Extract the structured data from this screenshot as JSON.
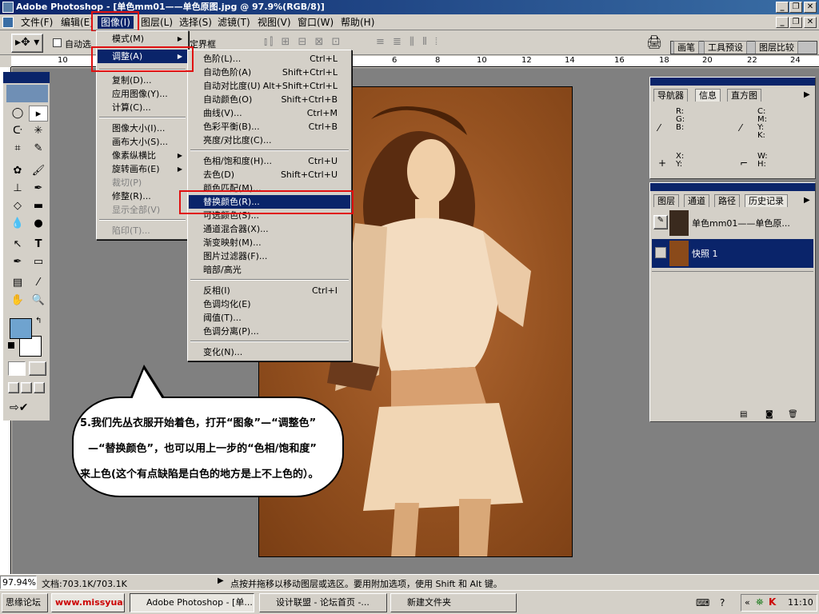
{
  "window": {
    "title": "Adobe Photoshop - [单色mm01——单色原图.jpg @ 97.9%(RGB/8)]",
    "btn_min": "_",
    "btn_restore": "❐",
    "btn_close": "✕"
  },
  "menubar": {
    "items": [
      "文件(F)",
      "编辑(E)",
      "图像(I)",
      "图层(L)",
      "选择(S)",
      "滤镜(T)",
      "视图(V)",
      "窗口(W)",
      "帮助(H)"
    ]
  },
  "options": {
    "auto_select": "自动选",
    "bounding_box": "定界框",
    "palette_tabs": [
      "画笔",
      "工具预设",
      "图层比较"
    ]
  },
  "ruler_h_ticks": [
    "10",
    "6",
    "8",
    "10",
    "12",
    "14",
    "16",
    "18",
    "20",
    "22",
    "24"
  ],
  "image_menu": {
    "items": [
      {
        "label": "模式(M)",
        "submenu": true
      },
      {
        "label": "调整(A)",
        "submenu": true,
        "selected": true
      },
      {
        "label": "复制(D)..."
      },
      {
        "label": "应用图像(Y)..."
      },
      {
        "label": "计算(C)..."
      },
      {
        "label": "图像大小(I)..."
      },
      {
        "label": "画布大小(S)..."
      },
      {
        "label": "像素纵横比",
        "submenu": true
      },
      {
        "label": "旋转画布(E)",
        "submenu": true
      },
      {
        "label": "裁切(P)",
        "disabled": true
      },
      {
        "label": "修整(R)..."
      },
      {
        "label": "显示全部(V)",
        "disabled": true
      },
      {
        "label": "陷印(T)...",
        "disabled": true
      }
    ]
  },
  "adjust_menu": {
    "items": [
      {
        "label": "色阶(L)...",
        "shortcut": "Ctrl+L"
      },
      {
        "label": "自动色阶(A)",
        "shortcut": "Shift+Ctrl+L"
      },
      {
        "label": "自动对比度(U)",
        "shortcut": "Alt+Shift+Ctrl+L"
      },
      {
        "label": "自动颜色(O)",
        "shortcut": "Shift+Ctrl+B"
      },
      {
        "label": "曲线(V)...",
        "shortcut": "Ctrl+M"
      },
      {
        "label": "色彩平衡(B)...",
        "shortcut": "Ctrl+B"
      },
      {
        "label": "亮度/对比度(C)...",
        "shortcut": ""
      },
      {
        "label": "色相/饱和度(H)...",
        "shortcut": "Ctrl+U"
      },
      {
        "label": "去色(D)",
        "shortcut": "Shift+Ctrl+U"
      },
      {
        "label": "颜色匹配(M)...",
        "shortcut": ""
      },
      {
        "label": "替换颜色(R)...",
        "shortcut": "",
        "selected": true
      },
      {
        "label": "可选颜色(S)...",
        "shortcut": ""
      },
      {
        "label": "通道混合器(X)...",
        "shortcut": ""
      },
      {
        "label": "渐变映射(M)...",
        "shortcut": ""
      },
      {
        "label": "图片过滤器(F)...",
        "shortcut": ""
      },
      {
        "label": "暗部/高光",
        "shortcut": ""
      },
      {
        "label": "反相(I)",
        "shortcut": "Ctrl+I"
      },
      {
        "label": "色调均化(E)",
        "shortcut": ""
      },
      {
        "label": "阈值(T)...",
        "shortcut": ""
      },
      {
        "label": "色调分离(P)...",
        "shortcut": ""
      },
      {
        "label": "变化(N)...",
        "shortcut": ""
      }
    ]
  },
  "info_palette": {
    "tabs": [
      "导航器",
      "信息",
      "直方图"
    ],
    "rgb": [
      "R:",
      "G:",
      "B:"
    ],
    "cmyk": [
      "C:",
      "M:",
      "Y:",
      "K:"
    ],
    "xy": [
      "X:",
      "Y:"
    ],
    "wh": [
      "W:",
      "H:"
    ]
  },
  "layers_palette": {
    "tabs": [
      "图层",
      "通道",
      "路径",
      "历史记录"
    ],
    "rows": [
      {
        "label": "单色mm01——单色原...",
        "selected": false
      },
      {
        "label": "快照 1",
        "selected": true
      }
    ]
  },
  "callout": {
    "line1": "5.我们先丛衣服开始着色，打开“图象”—“调整色”",
    "line2": "—“替换颜色”，也可以用上一步的“色相/饱和度”",
    "line3": "来上色(这个有点缺陷是白色的地方是上不上色的）。"
  },
  "status": {
    "zoom": "97.94%",
    "doc": "文档:703.1K/703.1K",
    "hint": "点按并拖移以移动图层或选区。要用附加选项，使用 Shift 和 Alt 键。"
  },
  "taskbar": {
    "buttons": [
      "思缘论坛",
      "",
      "Adobe Photoshop - [单...",
      "设计联盟 - 论坛首页 -...",
      "新建文件夹"
    ],
    "clock": "11:10",
    "tray_chevron": "«"
  },
  "colors": {
    "menu_highlight": "#0a246a",
    "annotation_red": "#e01010",
    "foreground": "#6fa3cf",
    "background": "#ffffff"
  }
}
